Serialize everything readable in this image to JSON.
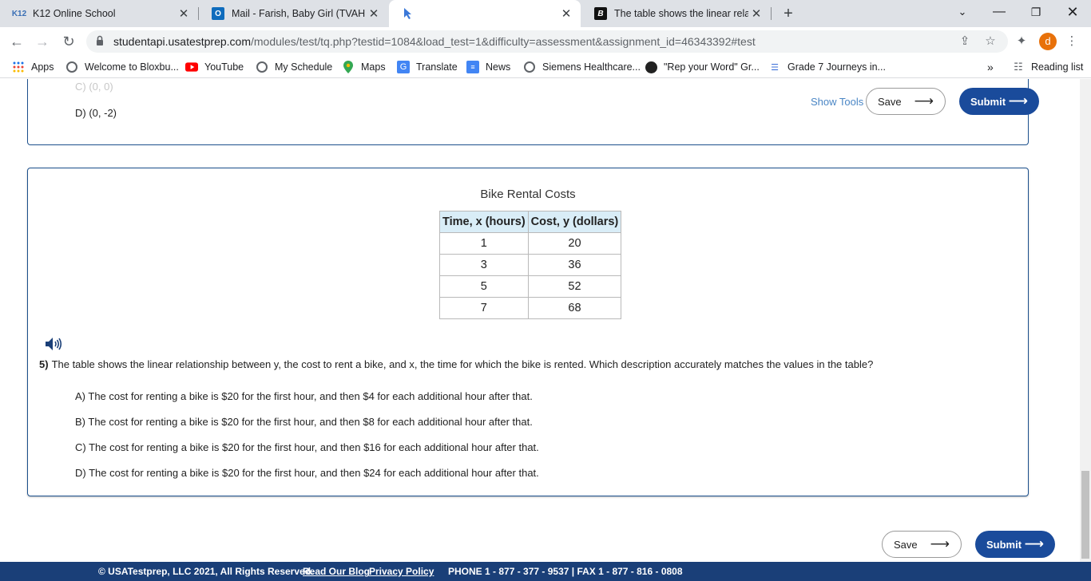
{
  "browser": {
    "tabs": [
      {
        "favicon": "K12",
        "title": "K12 Online School",
        "active": false
      },
      {
        "favicon": "outlook-icon",
        "title": "Mail - Farish, Baby Girl (TVAH Stu",
        "active": false
      },
      {
        "favicon": "cursor-icon",
        "title": "",
        "active": true
      },
      {
        "favicon": "B",
        "title": "The table shows the linear relatio",
        "active": false
      }
    ],
    "url_host": "studentapi.usatestprep.com",
    "url_path": "/modules/test/tq.php?testid=1084&load_test=1&difficulty=assessment&assignment_id=46343392#test",
    "profile_initial": "d",
    "bookmarks": [
      "Apps",
      "Welcome to Bloxbu...",
      "YouTube",
      "My Schedule",
      "Maps",
      "Translate",
      "News",
      "Siemens Healthcare...",
      "\"Rep your Word\" Gr...",
      "Grade 7 Journeys in..."
    ],
    "reading_list": "Reading list",
    "more": "»"
  },
  "previous_question": {
    "choice_c": "C) (0, 0)",
    "choice_d": "D) (0, -2)"
  },
  "tools": {
    "show_tools": "Show Tools",
    "save": "Save",
    "submit": "Submit",
    "arrow": "⟶"
  },
  "table": {
    "title": "Bike Rental Costs",
    "headers": [
      "Time, x (hours)",
      "Cost, y (dollars)"
    ],
    "rows": [
      [
        "1",
        "20"
      ],
      [
        "3",
        "36"
      ],
      [
        "5",
        "52"
      ],
      [
        "7",
        "68"
      ]
    ]
  },
  "question": {
    "number": "5)",
    "text": "The table shows the linear relationship between y, the cost to rent a bike, and x, the time for which the bike is rented. Which description accurately matches the values in the table?",
    "choices": [
      "A) The cost for renting a bike is $20 for the first hour, and then $4 for each additional hour after that.",
      "B) The cost for renting a bike is $20 for the first hour, and then $8 for each additional hour after that.",
      "C) The cost for renting a bike is $20 for the first hour, and then $16 for each additional hour after that.",
      "D) The cost for renting a bike is $20 for the first hour, and then $24 for each additional hour after that."
    ]
  },
  "bottom": {
    "save": "Save",
    "submit": "Submit"
  },
  "footer": {
    "copyright": "© USATestprep, LLC 2021, All Rights Reserved.",
    "blog": "Read Our Blog",
    "privacy": "Privacy Policy",
    "contact": "PHONE 1 - 877 - 377 - 9537 | FAX 1 - 877 - 816 - 0808"
  },
  "colors": {
    "accent": "#1a4b9b",
    "footer": "#1a3f78",
    "table_header": "#d9edf7"
  }
}
